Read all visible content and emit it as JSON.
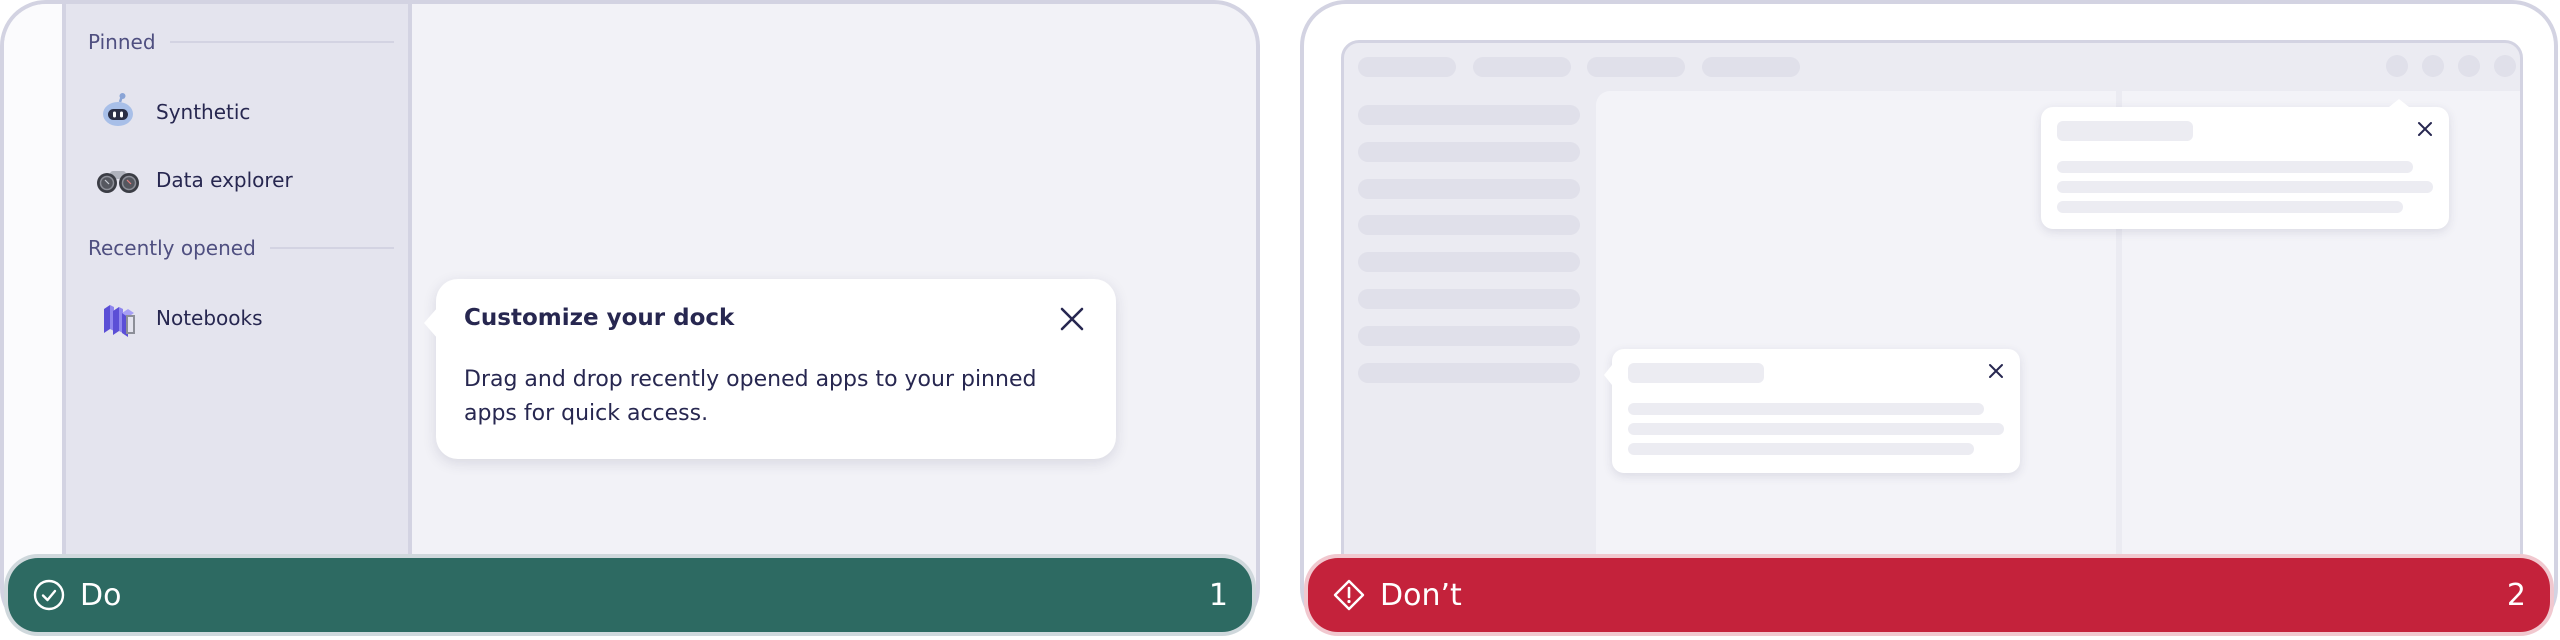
{
  "do_panel": {
    "sidebar": {
      "pinned_label": "Pinned",
      "pinned_items": [
        {
          "label": "Synthetic",
          "icon": "robot-icon"
        },
        {
          "label": "Data explorer",
          "icon": "binoculars-icon"
        }
      ],
      "recent_label": "Recently opened",
      "recent_items": [
        {
          "label": "Notebooks",
          "icon": "notebooks-cube-icon"
        }
      ]
    },
    "tooltip": {
      "title": "Customize your dock",
      "body": "Drag and drop recently opened apps to your pinned apps for quick access.",
      "close_icon": "close-icon"
    },
    "verdict": {
      "label": "Do",
      "number": "1",
      "icon": "check-circle-icon",
      "color": "#2d6a62"
    }
  },
  "dont_panel": {
    "mockup": {
      "tooltips": [
        {
          "position": "near sidebar",
          "close_icon": "close-icon"
        },
        {
          "position": "near toolbar",
          "close_icon": "close-icon"
        }
      ]
    },
    "verdict": {
      "label": "Don’t",
      "number": "2",
      "icon": "warning-diamond-icon",
      "color": "#c4223b"
    }
  },
  "colors": {
    "text": "#272750",
    "section_label": "#4f4f80",
    "border": "#d3d3e2",
    "sidebar_bg": "#e4e4ee",
    "main_bg": "#f2f2f7"
  }
}
